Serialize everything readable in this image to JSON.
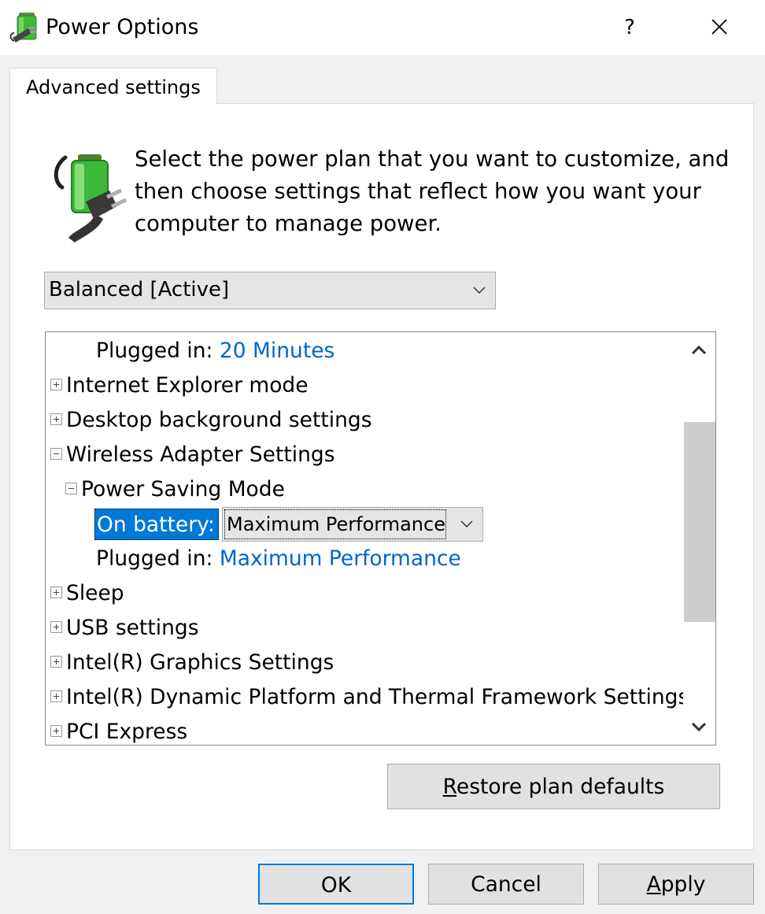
{
  "window": {
    "title": "Power Options",
    "help_label": "?"
  },
  "tabs": [
    {
      "label": "Advanced settings"
    }
  ],
  "description": "Select the power plan that you want to customize, and then choose settings that reflect how you want your computer to manage power.",
  "plan_select": {
    "selected": "Balanced [Active]"
  },
  "settings_tree": {
    "plugged_in_1": {
      "label": "Plugged in:",
      "value": "20 Minutes"
    },
    "items": {
      "internet_explorer": "Internet Explorer mode",
      "desktop_background": "Desktop background settings",
      "wireless_adapter": "Wireless Adapter Settings",
      "power_saving_mode": "Power Saving Mode",
      "sleep": "Sleep",
      "usb": "USB settings",
      "intel_graphics": "Intel(R) Graphics Settings",
      "intel_dptf": "Intel(R) Dynamic Platform and Thermal Framework Settings",
      "pci_express": "PCI Express"
    },
    "on_battery": {
      "label": "On battery:",
      "value": "Maximum Performance"
    },
    "plugged_in_2": {
      "label": "Plugged in:",
      "value": "Maximum Performance"
    }
  },
  "buttons": {
    "restore_prefix": "R",
    "restore_rest": "estore plan defaults",
    "ok": "OK",
    "cancel": "Cancel",
    "apply_prefix": "A",
    "apply_rest": "pply"
  },
  "colors": {
    "link": "#0066cc",
    "selection": "#0078d7",
    "battery_green": "#3db838"
  }
}
